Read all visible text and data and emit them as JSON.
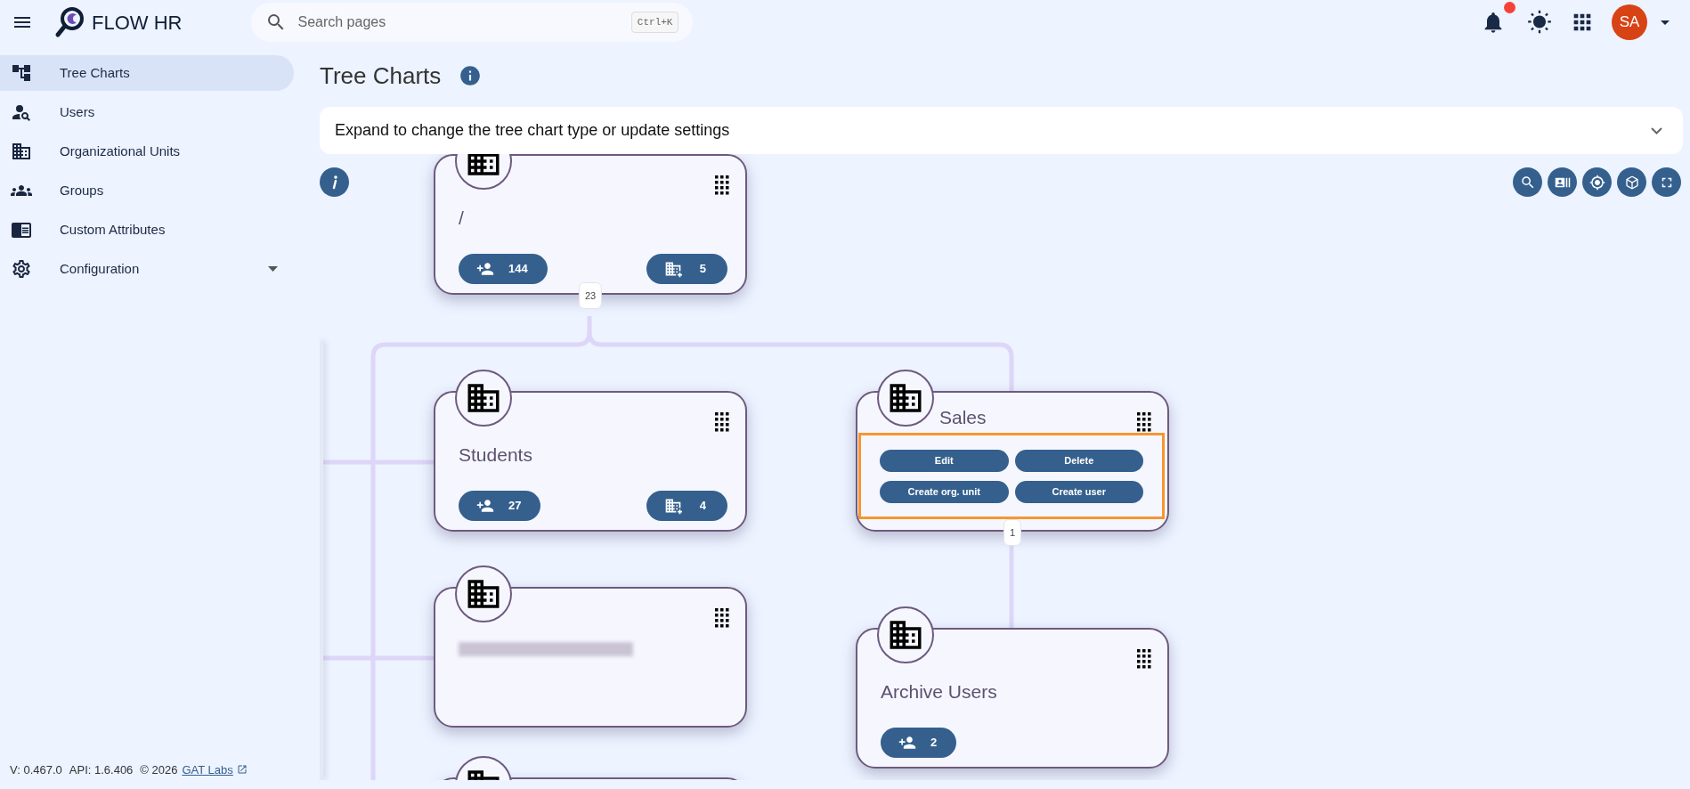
{
  "header": {
    "app_name": "FLOW HR",
    "search": {
      "placeholder": "Search pages",
      "shortcut": "Ctrl+K"
    },
    "has_notifications": true,
    "avatar": "SA"
  },
  "sidebar": {
    "items": [
      {
        "label": "Tree Charts",
        "selected": true,
        "kind": "tree"
      },
      {
        "label": "Users",
        "selected": false,
        "kind": "users"
      },
      {
        "label": "Organizational Units",
        "selected": false,
        "kind": "units"
      },
      {
        "label": "Groups",
        "selected": false,
        "kind": "groups"
      },
      {
        "label": "Custom Attributes",
        "selected": false,
        "kind": "attributes"
      },
      {
        "label": "Configuration",
        "selected": false,
        "kind": "settings",
        "expandable": true
      }
    ]
  },
  "footer": {
    "version": "V: 0.467.0",
    "api": "API: 1.6.406",
    "copyright": "© 2026",
    "link": "GAT Labs"
  },
  "page": {
    "title": "Tree Charts",
    "settings_panel": {
      "label": "Expand to change the tree chart type or update settings",
      "expanded": false
    }
  },
  "tree": {
    "nodes": [
      {
        "kind": "org_unit",
        "name": "/",
        "users": "144",
        "units": "5",
        "link_count": "23",
        "actions_open": false
      },
      {
        "kind": "org_unit",
        "name": "Students",
        "users": "27",
        "units": "4",
        "actions_open": false
      },
      {
        "kind": "org_unit",
        "name": "Sales",
        "link_count": "1",
        "actions_open": true,
        "actions": [
          "Edit",
          "Delete",
          "Create org. unit",
          "Create user"
        ]
      },
      {
        "kind": "org_unit",
        "redacted": true
      },
      {
        "kind": "org_unit",
        "name": "Archive Users",
        "users": "2",
        "actions_open": false
      },
      {
        "kind": "org_unit"
      }
    ]
  }
}
